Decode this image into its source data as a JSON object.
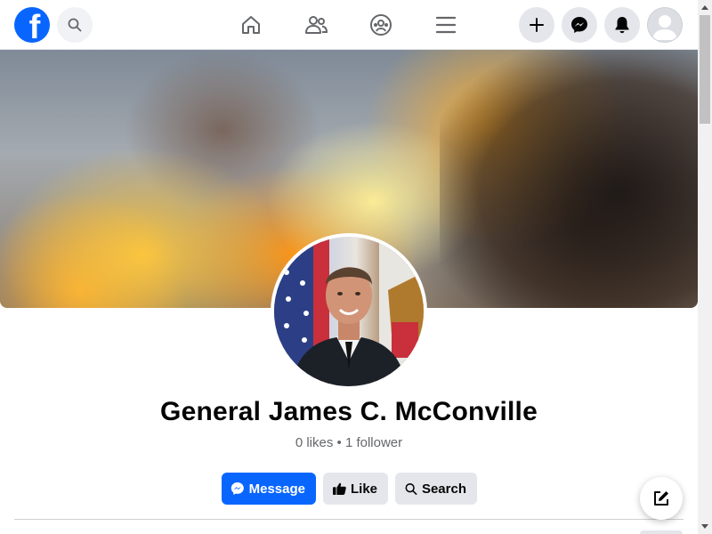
{
  "nav": {
    "logo": "f",
    "icons": {
      "search": "search-icon",
      "home": "home-icon",
      "friends": "friends-icon",
      "groups": "groups-icon",
      "menu": "menu-icon",
      "create": "plus-icon",
      "messenger": "messenger-icon",
      "notifications": "bell-icon",
      "account": "avatar"
    }
  },
  "profile": {
    "name": "General James C. McConville",
    "stats": "0 likes • 1 follower"
  },
  "actions": {
    "message_label": "Message",
    "like_label": "Like",
    "search_label": "Search"
  },
  "colors": {
    "accent": "#0866ff",
    "secondary_button": "#e4e6eb",
    "muted_text": "#65676b"
  }
}
